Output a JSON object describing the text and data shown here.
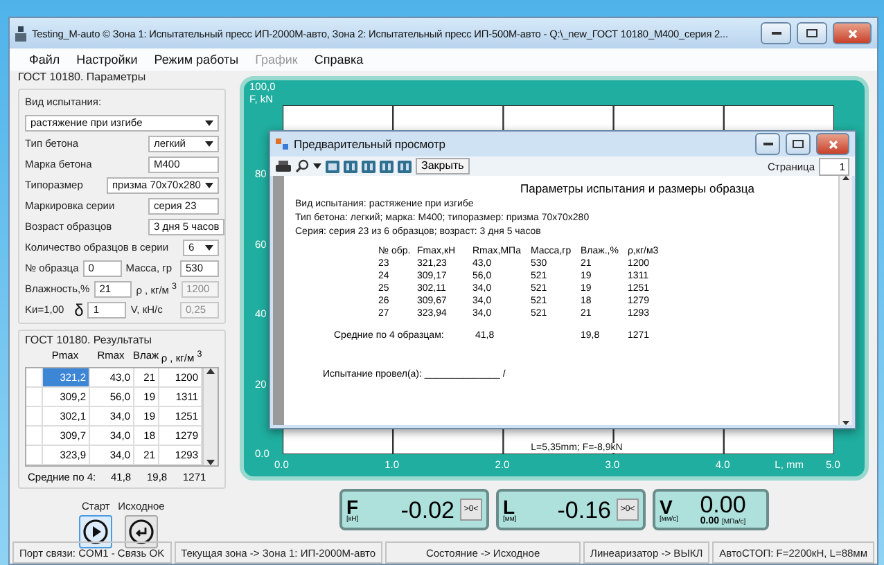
{
  "window": {
    "title": "Testing_M-auto ©  Зона 1: Испытательный пресс ИП-2000М-авто, Зона 2: Испытательный пресс ИП-500М-авто - Q:\\_new_ГОСТ 10180_M400_серия 2..."
  },
  "menu": [
    {
      "label": "Файл",
      "disabled": false
    },
    {
      "label": "Настройки",
      "disabled": false
    },
    {
      "label": "Режим работы",
      "disabled": false
    },
    {
      "label": "График",
      "disabled": true
    },
    {
      "label": "Справка",
      "disabled": false
    }
  ],
  "params": {
    "title": "ГОСТ 10180. Параметры",
    "rows": [
      {
        "kind": "caption",
        "label": "Вид испытания:"
      },
      {
        "kind": "wide",
        "value": "растяжение при изгибе"
      },
      {
        "kind": "select",
        "label": "Тип бетона",
        "value": "легкий"
      },
      {
        "kind": "input",
        "label": "Марка бетона",
        "value": "M400"
      },
      {
        "kind": "long-select",
        "label": "Типоразмер",
        "value": "призма 70x70x280"
      },
      {
        "kind": "input",
        "label": "Маркировка серии",
        "value": "серия 23"
      },
      {
        "kind": "input",
        "label": "Возраст образцов",
        "value": "3 дня 5 часов"
      },
      {
        "kind": "short-select",
        "label": "Количество образцов в серии",
        "value": "6"
      }
    ],
    "pairs": [
      [
        {
          "kind": "label",
          "text": "№ образца"
        },
        {
          "kind": "field",
          "value": "0",
          "disabled": false
        },
        {
          "kind": "label",
          "text": "Масса, гр"
        },
        {
          "kind": "field",
          "value": "530",
          "disabled": false
        }
      ],
      [
        {
          "kind": "label",
          "text": "Влажность,%"
        },
        {
          "kind": "field",
          "value": "21",
          "disabled": false
        },
        {
          "kind": "label",
          "text": "ρ , кг/м $^{3}$"
        },
        {
          "kind": "field",
          "value": "1200",
          "disabled": true
        }
      ],
      [
        {
          "kind": "label",
          "text": "Kи=1,00"
        },
        {
          "kind": "symbol",
          "text": "δ"
        },
        {
          "kind": "field",
          "value": "1",
          "disabled": false
        },
        {
          "kind": "label",
          "text": "V, кН/с"
        },
        {
          "kind": "field",
          "value": "0,25",
          "disabled": true
        }
      ]
    ]
  },
  "results": {
    "title": "ГОСТ 10180. Результаты",
    "columns": [
      "Pmax",
      "Rmax",
      "Влаж",
      "ρ , кг/м $^{3}$"
    ],
    "rows": [
      {
        "cells": [
          "321,2",
          "43,0",
          "21",
          "1200"
        ],
        "selected": true
      },
      {
        "cells": [
          "309,2",
          "56,0",
          "19",
          "1311"
        ],
        "selected": false
      },
      {
        "cells": [
          "302,1",
          "34,0",
          "19",
          "1251"
        ],
        "selected": false
      },
      {
        "cells": [
          "309,7",
          "34,0",
          "18",
          "1279"
        ],
        "selected": false
      },
      {
        "cells": [
          "323,9",
          "34,0",
          "21",
          "1293"
        ],
        "selected": false
      }
    ],
    "averages": [
      "Средние по 4:",
      "41,8",
      "19,8",
      "1271"
    ]
  },
  "actions": [
    {
      "kind": "start",
      "label": "Старт",
      "selected": true
    },
    {
      "kind": "reset",
      "label": "Исходное",
      "selected": false
    }
  ],
  "chart": {
    "ylabel": "F, kN",
    "xlabel": "L, mm",
    "yticks": [
      "100,0",
      "80",
      "60",
      "40",
      "20",
      "0.0"
    ],
    "xticks": [
      "0.0",
      "1.0",
      "2.0",
      "3.0",
      "4.0",
      "5.0"
    ],
    "cursor": "L=5,35mm; F=-8,9kN"
  },
  "preview": {
    "title": "Предварительный просмотр",
    "close": "Закрыть",
    "page_label": "Страница",
    "page": "1",
    "heading": "Параметры испытания и размеры образца",
    "lines": [
      "Вид испытания: растяжение при изгибе",
      "Тип бетона: легкий;  марка: M400;  типоразмер: призма 70x70x280",
      "Серия: серия 23 из 6 образцов;  возраст: 3 дня 5 часов"
    ],
    "columns": [
      "№ обр.",
      "Fmax,кН",
      "Rmax,МПа",
      "Масса,гр",
      "Влаж.,%",
      "ρ,кг/м3"
    ],
    "rows": [
      [
        "23",
        "321,23",
        "43,0",
        "530",
        "21",
        "1200"
      ],
      [
        "24",
        "309,17",
        "56,0",
        "521",
        "19",
        "1311"
      ],
      [
        "25",
        "302,11",
        "34,0",
        "521",
        "19",
        "1251"
      ],
      [
        "26",
        "309,67",
        "34,0",
        "521",
        "18",
        "1279"
      ],
      [
        "27",
        "323,94",
        "34,0",
        "521",
        "21",
        "1293"
      ]
    ],
    "averages": {
      "label": "Средние по 4 образцам:",
      "rmax": "41,8",
      "moisture": "19,8",
      "density": "1271"
    },
    "signature": "Испытание провел(а): ______________ /"
  },
  "meters": [
    {
      "kind": "zeroable",
      "symbol": "F",
      "unit": "[кН]",
      "value": "-0.02",
      "button": ">0<"
    },
    {
      "kind": "zeroable",
      "symbol": "L",
      "unit": "[мм]",
      "value": "-0.16",
      "button": ">0<"
    },
    {
      "kind": "speed",
      "symbol": "V",
      "unit": "[мм/с]",
      "value": "0.00",
      "sub_value": "0.00",
      "sub_unit": "[МПа/с]"
    }
  ],
  "status_bar": [
    "Порт связи: COM1 - Связь OK",
    "Текущая зона -> Зона 1: ИП-2000М-авто",
    "Состояние -> Исходное",
    "Линеаризатор -> ВЫКЛ",
    "АвтоСТОП: F=2200кН, L=88мм"
  ]
}
